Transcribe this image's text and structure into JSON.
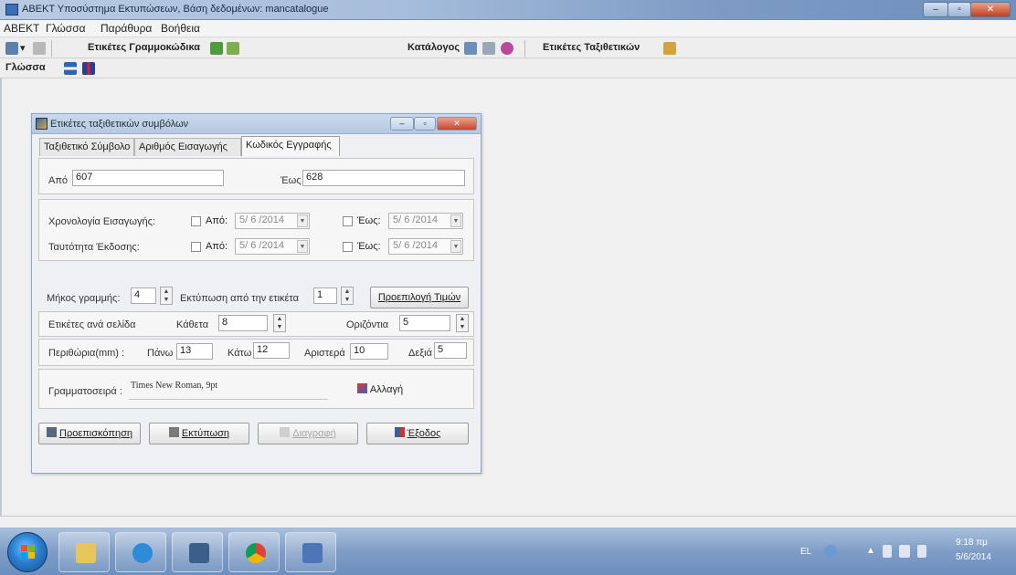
{
  "app": {
    "title": "ΑΒΕΚΤ Υποσύστημα Εκτυπώσεων, Βάση δεδομένων: mancatalogue",
    "menu": [
      "ΑΒΕΚΤ",
      "Γλώσσα",
      "Παράθυρα",
      "Βοήθεια"
    ],
    "toolbar": {
      "labels_card": "Ετικέτες Γραμμοκώδικα",
      "catalog": "Κατάλογος",
      "labels_shelf": "Ετικέτες Ταξιθετικών",
      "language": "Γλώσσα"
    }
  },
  "dialog": {
    "title": "Ετικέτες ταξιθετικών συμβόλων",
    "tabs": [
      "Ταξιθετικό Σύμβολο",
      "Αριθμός Εισαγωγής",
      "Κωδικός Εγγραφής"
    ],
    "active_tab": 2,
    "range": {
      "from_label": "Από",
      "from_value": "607",
      "to_label": "Έως",
      "to_value": "628"
    },
    "chronology": {
      "label": "Χρονολογία Εισαγωγής:",
      "from_label": "Από:",
      "from_date": "5/ 6 /2014",
      "to_label": "Έως:",
      "to_date": "5/ 6 /2014"
    },
    "identity": {
      "label": "Ταυτότητα Έκδοσης:",
      "from_label": "Από:",
      "from_date": "5/ 6 /2014",
      "to_label": "Έως:",
      "to_date": "5/ 6 /2014"
    },
    "line_length": {
      "label": "Μήκος γραμμής:",
      "value": "4"
    },
    "print_from": {
      "label": "Εκτύπωση από την ετικέτα",
      "value": "1"
    },
    "default_values_button": "Προεπιλογή Τιμών",
    "labels_per_page": {
      "label": "Ετικέτες ανά σελίδα",
      "vertical_label": "Κάθετα",
      "vertical_value": "8",
      "horizontal_label": "Οριζόντια",
      "horizontal_value": "5"
    },
    "margins": {
      "label": "Περιθώρια(mm) :",
      "top_label": "Πάνω",
      "top_value": "13",
      "bottom_label": "Κάτω",
      "bottom_value": "12",
      "left_label": "Αριστερά",
      "left_value": "10",
      "right_label": "Δεξιά",
      "right_value": "5"
    },
    "font": {
      "label": "Γραμματοσειρά :",
      "value": "Times New Roman, 9pt",
      "change_button": "Αλλαγή"
    },
    "buttons": {
      "preview": "Προεπισκόπηση",
      "print": "Εκτύπωση",
      "delete": "Διαγραφή",
      "exit": "Έξοδος"
    }
  },
  "tray": {
    "lang": "EL",
    "time": "9:18 πμ",
    "date": "5/6/2014"
  }
}
